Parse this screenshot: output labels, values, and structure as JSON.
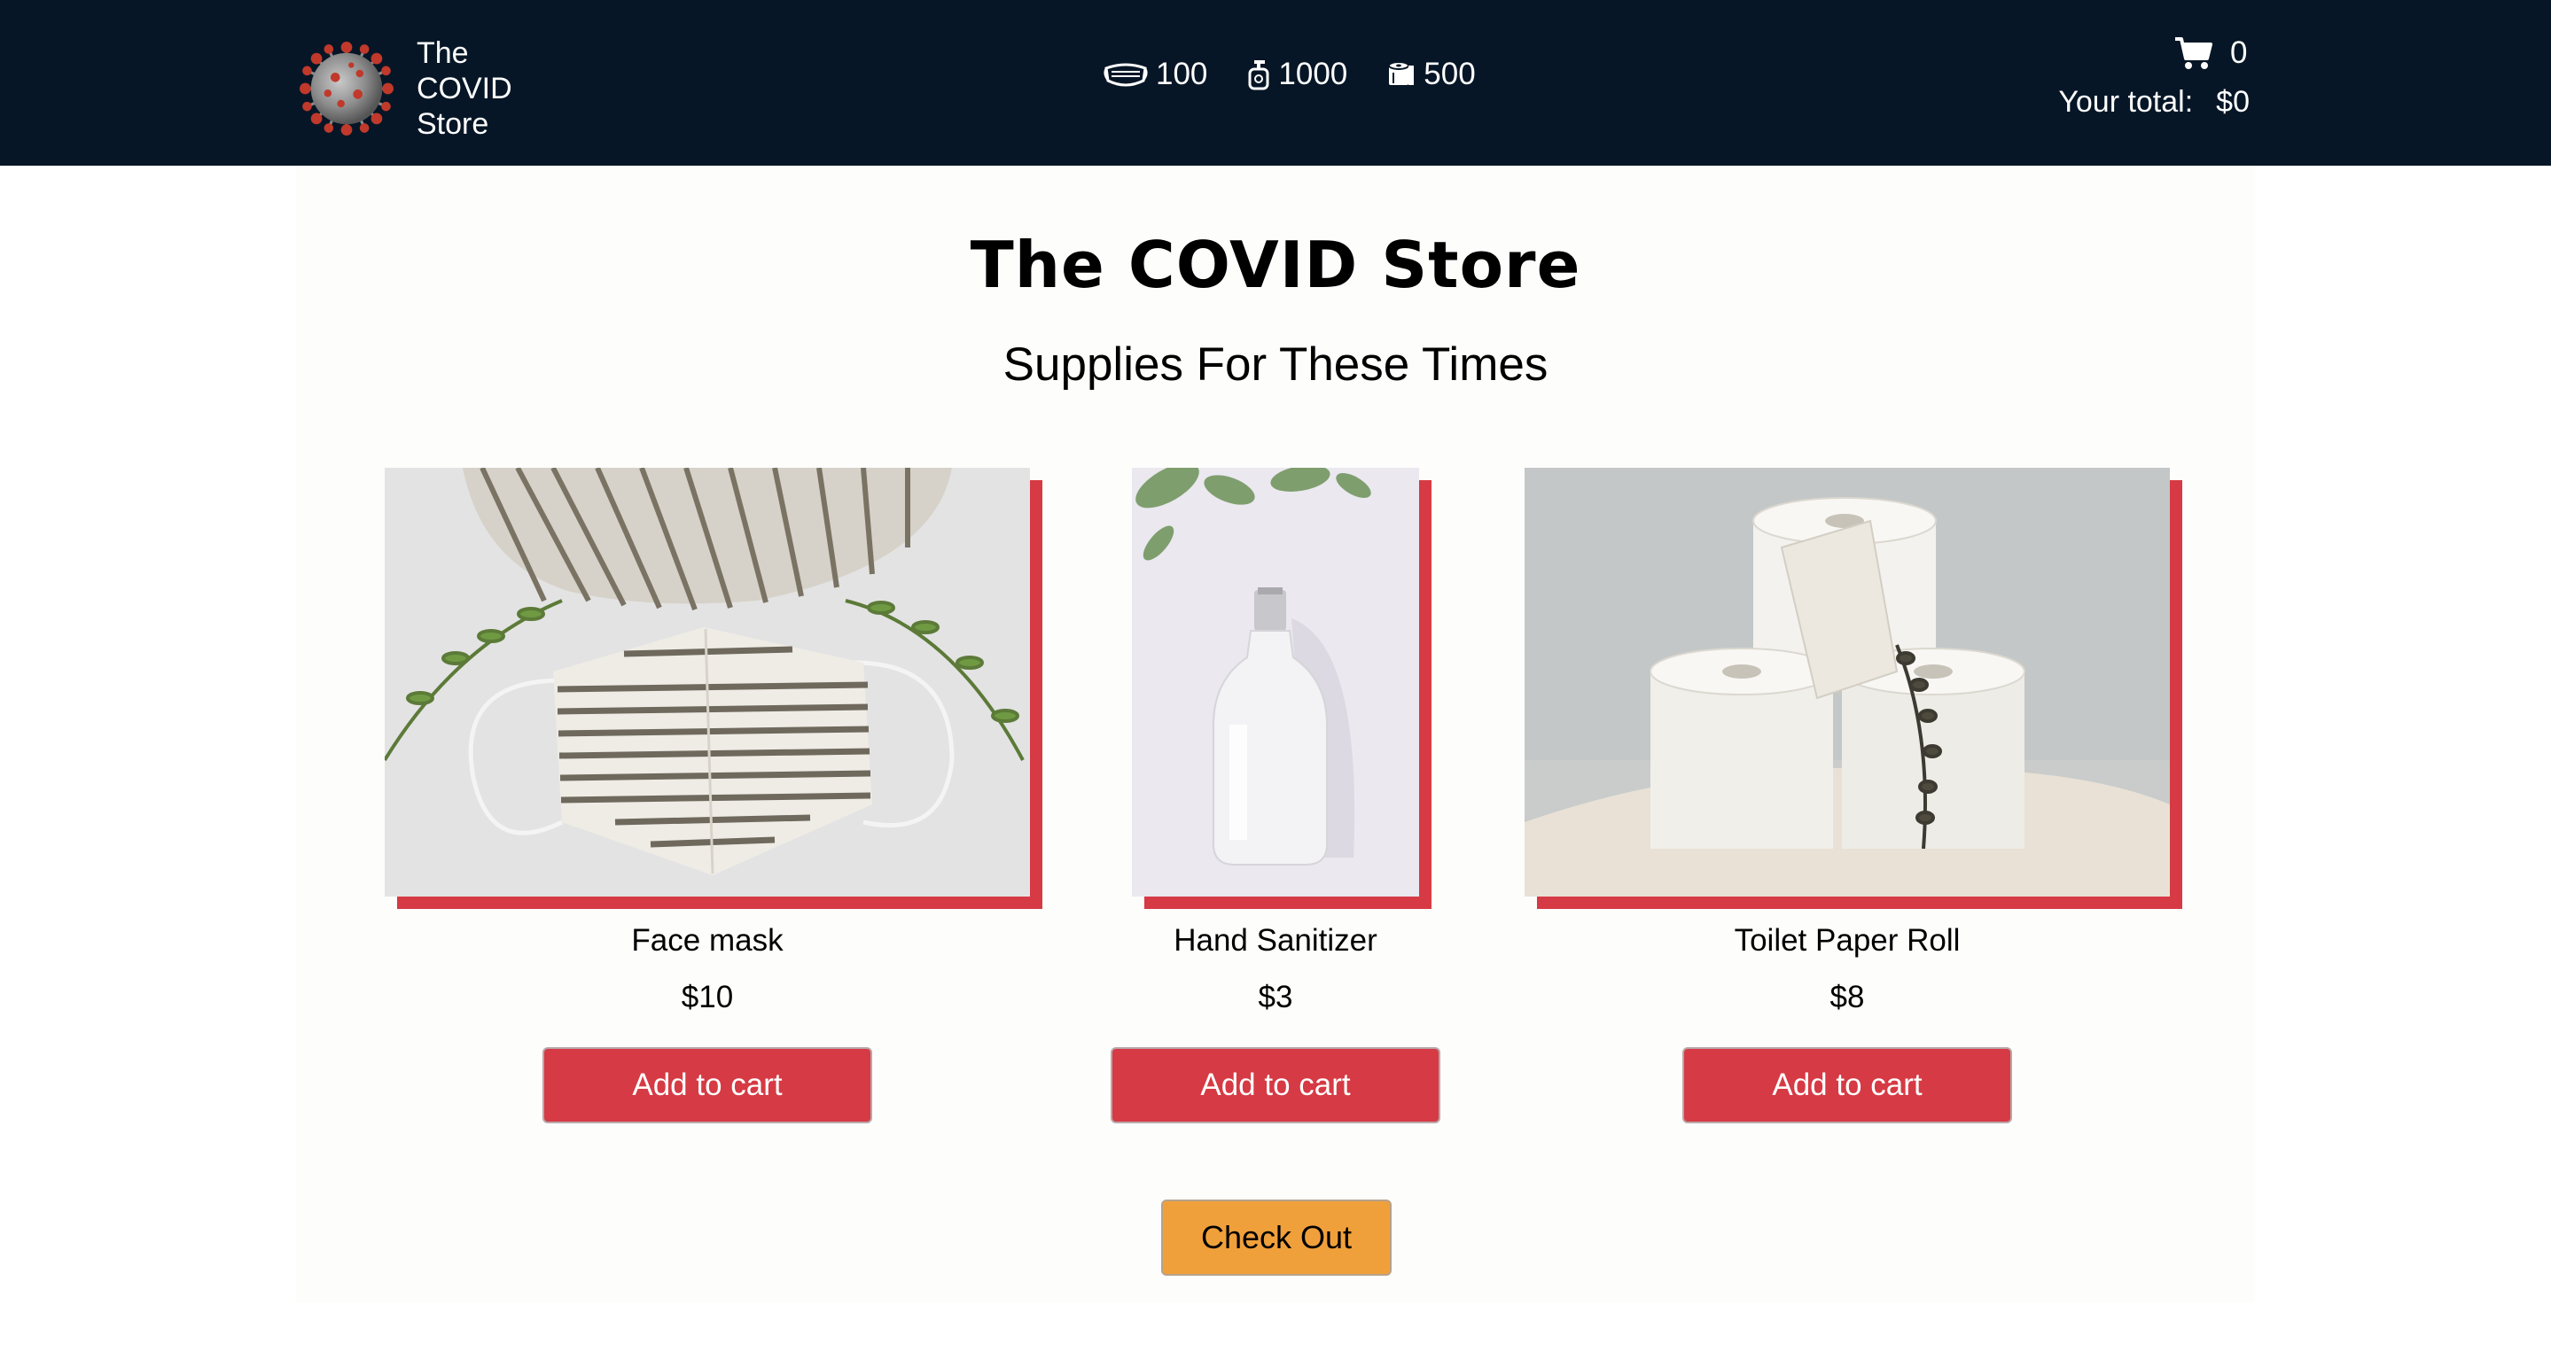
{
  "nav": {
    "brand_name": "The COVID Store",
    "logo_icon": "coronavirus-logo",
    "stock": [
      {
        "icon": "mask-icon",
        "count": "100"
      },
      {
        "icon": "sanitizer-icon",
        "count": "1000"
      },
      {
        "icon": "toilet-paper-icon",
        "count": "500"
      }
    ],
    "cart": {
      "icon": "shopping-cart-icon",
      "count": "0",
      "total_label": "Your total:",
      "total_value": "$0"
    }
  },
  "page": {
    "title": "The COVID Store",
    "subtitle": "Supplies For These Times"
  },
  "products": [
    {
      "name": "Face mask",
      "price": "$10",
      "button": "Add to cart",
      "image": "striped-face-mask-photo"
    },
    {
      "name": "Hand Sanitizer",
      "price": "$3",
      "button": "Add to cart",
      "image": "hand-sanitizer-bottle-photo"
    },
    {
      "name": "Toilet Paper Roll",
      "price": "$8",
      "button": "Add to cart",
      "image": "toilet-paper-rolls-photo"
    }
  ],
  "checkout": {
    "label": "Check Out"
  },
  "colors": {
    "navbar": "#061626",
    "accent_red": "#d63a44",
    "checkout_orange": "#f0a03b",
    "main_bg": "#fdfdfc"
  }
}
